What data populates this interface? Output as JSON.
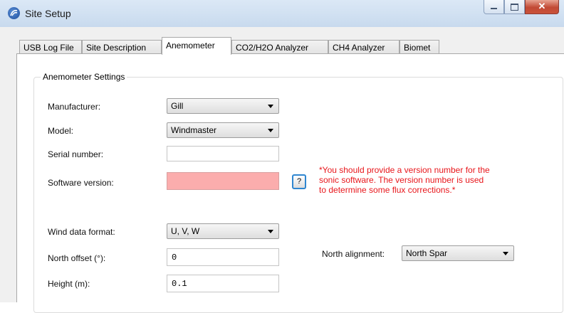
{
  "window": {
    "title": "Site Setup",
    "controls": {
      "minimize": "minimize-icon",
      "maximize": "maximize-icon",
      "close": "✕"
    }
  },
  "tabs": [
    {
      "label": "USB Log File"
    },
    {
      "label": "Site Description"
    },
    {
      "label": "Anemometer",
      "active": true
    },
    {
      "label": "CO2/H2O Analyzer"
    },
    {
      "label": "CH4 Analyzer"
    },
    {
      "label": "Biomet"
    }
  ],
  "anemometer": {
    "group_title": "Anemometer Settings",
    "manufacturer": {
      "label": "Manufacturer:",
      "value": "Gill"
    },
    "model": {
      "label": "Model:",
      "value": "Windmaster"
    },
    "serial_number": {
      "label": "Serial number:",
      "value": ""
    },
    "software_version": {
      "label": "Software version:",
      "value": "",
      "state_color": "#fbadad"
    },
    "help_button": "?",
    "warning_lines": [
      "*You should provide a version number for the",
      "sonic software.  The version number is used",
      "to determine some flux corrections.*"
    ],
    "warning_color": "#e8161b",
    "wind_data_format": {
      "label": "Wind data format:",
      "value": "U, V, W"
    },
    "north_offset": {
      "label": "North offset (°):",
      "value": "0"
    },
    "north_alignment": {
      "label": "North alignment:",
      "value": "North Spar"
    },
    "height": {
      "label": "Height (m):",
      "value": "0.1"
    }
  }
}
